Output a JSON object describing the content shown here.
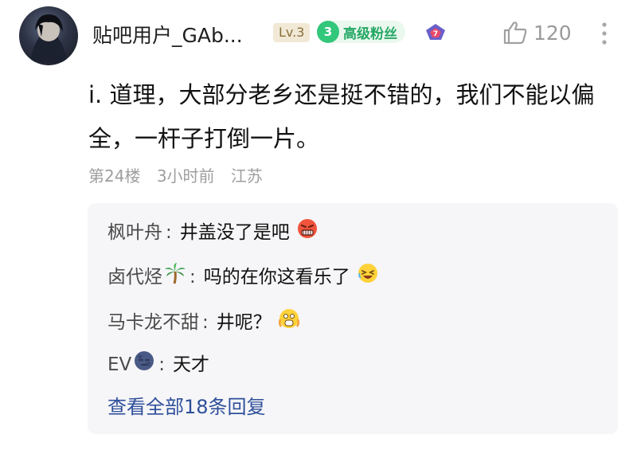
{
  "post": {
    "username": "贴吧用户_GAb...",
    "level_badge": "Lv.3",
    "fan_level": "3",
    "fan_label": "高级粉丝",
    "like_count": "120",
    "content": "i. 道理，大部分老乡还是挺不错的，我们不能以偏 全，一杆子打倒一片。",
    "floor": "第24楼",
    "time": "3小时前",
    "location": "江苏"
  },
  "replies": [
    {
      "author": "枫叶舟",
      "author_emoji": "",
      "text": "井盖没了是吧",
      "emoji": "angry-emoji"
    },
    {
      "author": "卤代烃",
      "author_emoji": "palm-tree-emoji",
      "text": "吗的在你这看乐了",
      "emoji": "laughing-emoji"
    },
    {
      "author": "马卡龙不甜",
      "author_emoji": "",
      "text": "井呢？",
      "emoji": "scared-emoji"
    },
    {
      "author": "EV",
      "author_emoji": "moon-face-emoji",
      "text": "天才",
      "emoji": ""
    }
  ],
  "view_all": "查看全部18条回复",
  "colors": {
    "link": "#2e4f9a",
    "fan_green": "#33c77b",
    "reply_bg": "#f6f6f8",
    "meta_gray": "#9e9e9e"
  }
}
